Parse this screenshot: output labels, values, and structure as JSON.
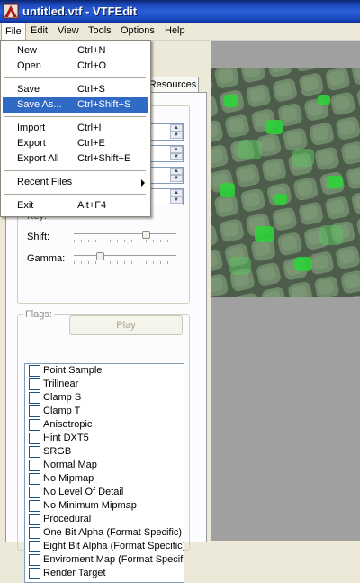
{
  "window": {
    "title": "untitled.vtf - VTFEdit"
  },
  "menubar": {
    "items": [
      "File",
      "Edit",
      "View",
      "Tools",
      "Options",
      "Help"
    ]
  },
  "file_menu": {
    "items": [
      {
        "label": "New",
        "shortcut": "Ctrl+N"
      },
      {
        "label": "Open",
        "shortcut": "Ctrl+O"
      },
      {
        "label": "Save",
        "shortcut": "Ctrl+S"
      },
      {
        "label": "Save As...",
        "shortcut": "Ctrl+Shift+S",
        "highlighted": true
      },
      {
        "label": "Import",
        "shortcut": "Ctrl+I"
      },
      {
        "label": "Export",
        "shortcut": "Ctrl+E"
      },
      {
        "label": "Export All",
        "shortcut": "Ctrl+Shift+E"
      },
      {
        "label": "Recent Files",
        "shortcut": ""
      },
      {
        "label": "Exit",
        "shortcut": "Alt+F4"
      }
    ]
  },
  "tabs": {
    "resources": "Resources"
  },
  "image_controls": {
    "key_label": "Key:",
    "shift_label": "Shift:",
    "gamma_label": "Gamma:",
    "play_button": "Play",
    "shift_value": 0.7,
    "gamma_value": 0.25
  },
  "flags": {
    "legend": "Flags:",
    "items": [
      "Point Sample",
      "Trilinear",
      "Clamp S",
      "Clamp T",
      "Anisotropic",
      "Hint DXT5",
      "SRGB",
      "Normal Map",
      "No Mipmap",
      "No Level Of Detail",
      "No Minimum Mipmap",
      "Procedural",
      "One Bit Alpha (Format Specific)",
      "Eight Bit Alpha (Format Specific)",
      "Enviroment Map (Format Specific)",
      "Render Target"
    ]
  },
  "colors": {
    "highlight": "#316ac5",
    "titlebar": "#1b46b8",
    "texture_green": "#38d040"
  }
}
